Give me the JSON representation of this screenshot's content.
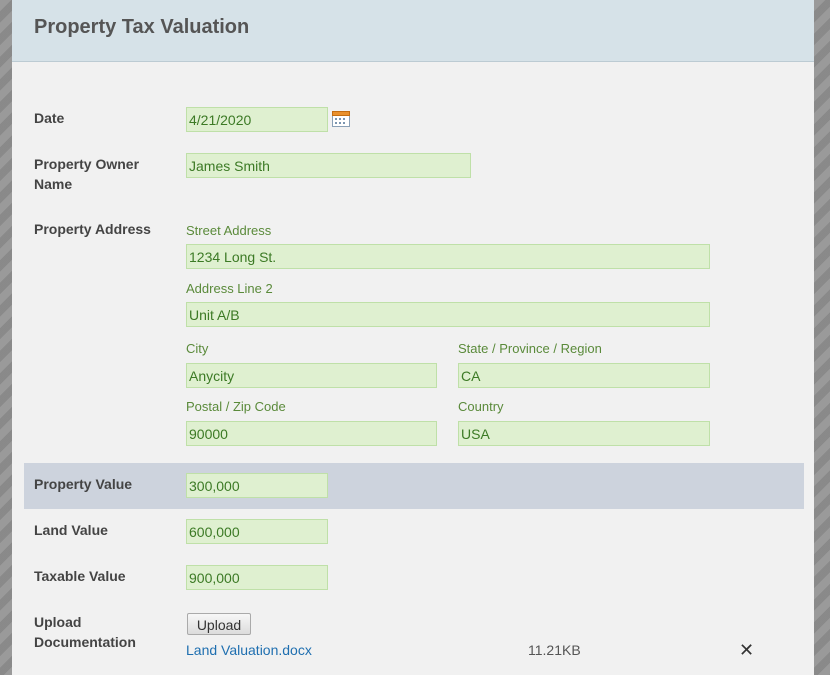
{
  "header": {
    "title": "Property Tax Valuation"
  },
  "date": {
    "label": "Date",
    "value": "4/21/2020"
  },
  "owner": {
    "label_line1": "Property Owner",
    "label_line2": "Name",
    "value": "James Smith"
  },
  "address": {
    "label": "Property Address",
    "street": {
      "label": "Street Address",
      "value": "1234 Long St."
    },
    "line2": {
      "label": "Address Line 2",
      "value": "Unit A/B"
    },
    "city": {
      "label": "City",
      "value": "Anycity"
    },
    "state": {
      "label": "State / Province / Region",
      "value": "CA"
    },
    "postal": {
      "label": "Postal / Zip Code",
      "value": "90000"
    },
    "country": {
      "label": "Country",
      "value": "USA"
    }
  },
  "property_value": {
    "label": "Property Value",
    "value": "300,000"
  },
  "land_value": {
    "label": "Land Value",
    "value": "600,000"
  },
  "taxable_value": {
    "label": "Taxable Value",
    "value": "900,000"
  },
  "upload": {
    "label_line1": "Upload",
    "label_line2": "Documentation",
    "button_label": "Upload",
    "file_name": "Land Valuation.docx",
    "file_size": "11.21KB",
    "remove_glyph": "✕"
  },
  "icons": {
    "calendar": "calendar-icon",
    "remove": "close-icon"
  }
}
